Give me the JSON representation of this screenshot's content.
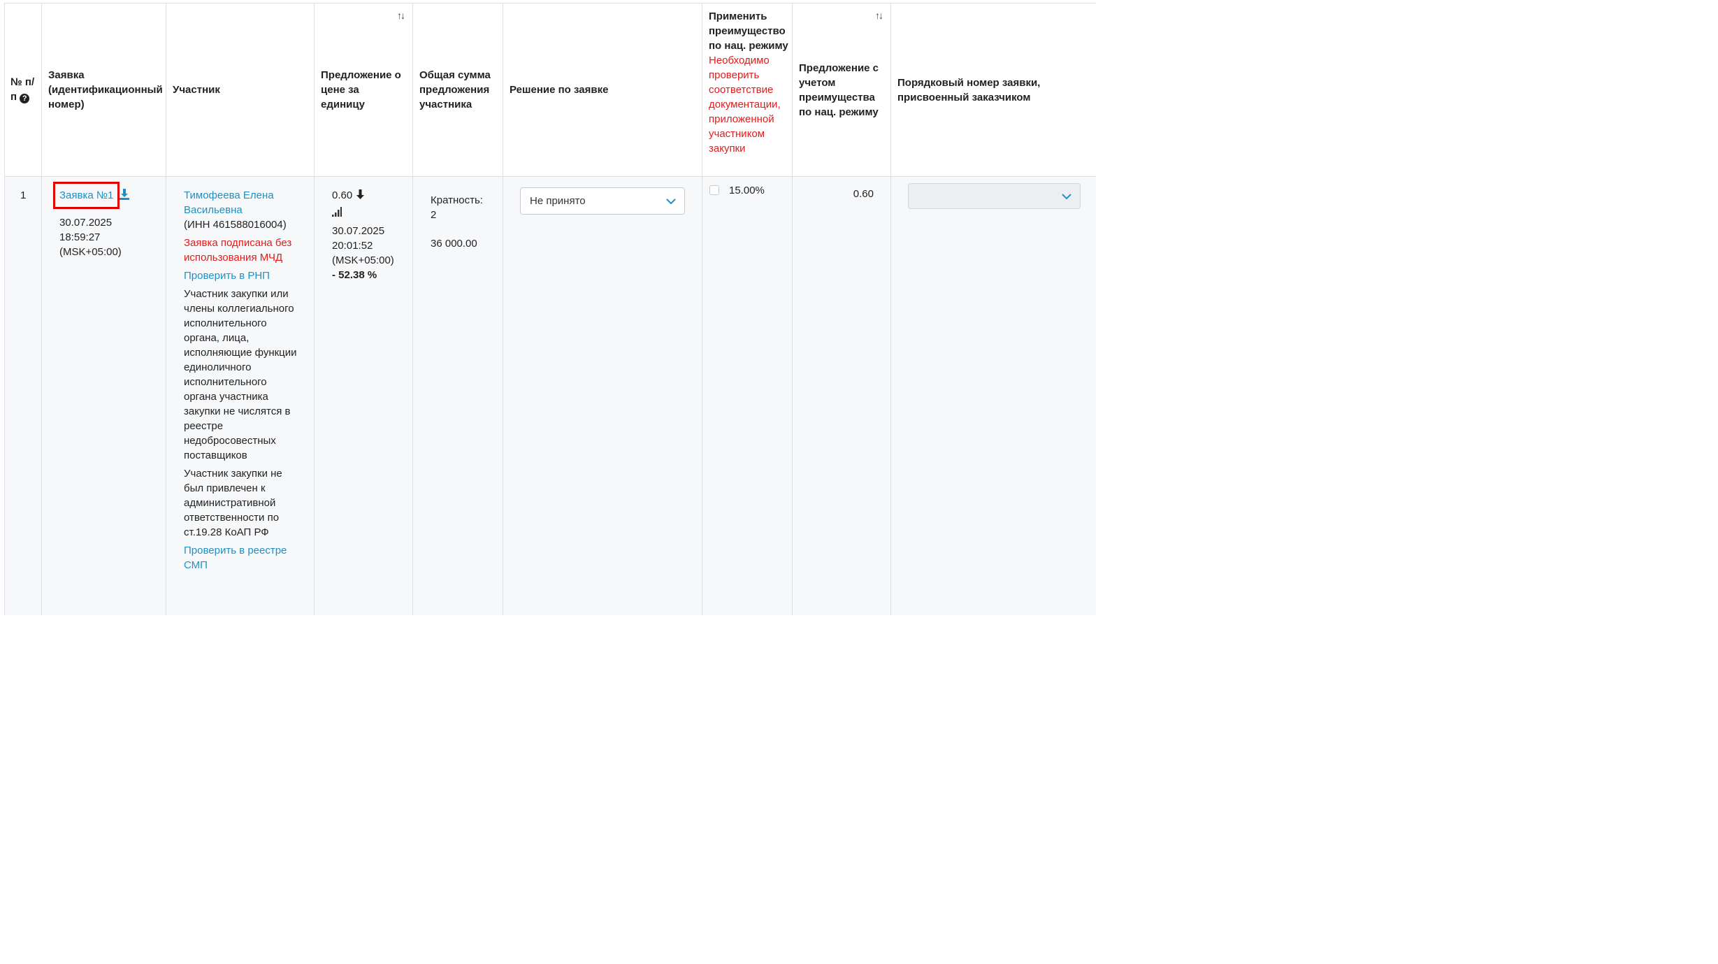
{
  "headers": {
    "num": "№ п/п",
    "application": "Заявка (идентификационный номер)",
    "participant": "Участник",
    "unit_price": "Предложение о цене за единицу",
    "total": "Общая сумма предложения участника",
    "decision": "Решение по заявке",
    "advantage_title": "Применить преимущество по нац. режиму",
    "advantage_warning": "Необходимо проверить соответствие документации, приложенной участником закупки",
    "with_advantage": "Предложение с учетом преимущества по нац. режиму",
    "order_number": "Порядковый номер заявки, присвоенный заказчиком"
  },
  "row": {
    "num": "1",
    "application_link": "Заявка №1",
    "app_date": "30.07.2025",
    "app_time": "18:59:27",
    "app_tz": "(MSK+05:00)",
    "participant_name": "Тимофеева Елена Васильевна",
    "participant_inn": "(ИНН 461588016004)",
    "signed_warning": "Заявка подписана без использования МЧД",
    "check_rnp": "Проверить в РНП",
    "rnp_text": "Участник закупки или члены коллегиального исполнительного органа, лица, исполняющие функции единоличного исполнительного органа участника закупки не числятся в реестре недобросовестных поставщиков",
    "koap_text": "Участник закупки не был привлечен к административной ответственности по ст.19.28 КоАП РФ",
    "check_smp": "Проверить в реестре СМП",
    "price": "0.60",
    "price_date": "30.07.2025",
    "price_time": "20:01:52",
    "price_tz": "(MSK+05:00)",
    "price_percent": "- 52.38 %",
    "multiplicity_label": "Кратность:",
    "multiplicity_value": "2",
    "total_sum": "36 000.00",
    "decision_value": "Не принято",
    "advantage_percent": "15.00%",
    "with_advantage_value": "0.60",
    "order_number_value": ""
  },
  "colors": {
    "link": "#1e90c3",
    "warning": "#e31b1b",
    "highlight": "#e00000"
  },
  "icons": {
    "sort": "sort-icon",
    "help": "question-icon",
    "download": "download-icon",
    "price_down": "arrow-down-icon",
    "bars": "signal-bars-icon",
    "chevron": "chevron-down-icon"
  }
}
